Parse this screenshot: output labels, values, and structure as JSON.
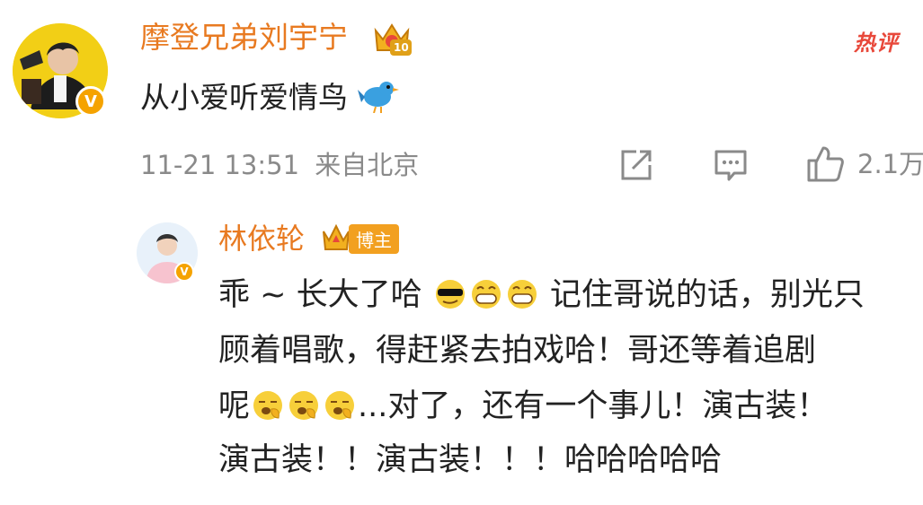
{
  "comment": {
    "username": "摩登兄弟刘宇宁",
    "text": "从小爱听爱情鸟",
    "timestamp": "11-21 13:51",
    "source": "来自北京",
    "likes": "2.1万",
    "hot_tag": "热评",
    "level_badge": "10"
  },
  "reply": {
    "username": "林依轮",
    "badge_label": "博主",
    "lines": [
      {
        "before": "乖 ~ 长大了哈",
        "after": "记住哥说的话，别光只"
      },
      {
        "text": "顾着唱歌，得赶紧去拍戏哈！哥还等着追剧"
      },
      {
        "before": "呢",
        "after": "...对了，还有一个事儿！演古装！"
      },
      {
        "text": "演古装！！演古装！！！哈哈哈哈哈"
      }
    ]
  },
  "icons": [
    "share-icon",
    "comment-icon",
    "like-icon",
    "crown-icon",
    "bird-emoji",
    "cool-emoji",
    "grin-emoji",
    "yawn-emoji"
  ],
  "colors": {
    "username": "#e87a21",
    "hot": "#e8483a",
    "verified": "#f5a300",
    "meta": "#8a8a8a"
  }
}
